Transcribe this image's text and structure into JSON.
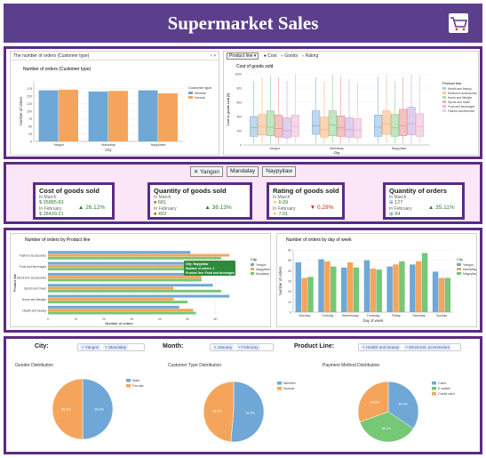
{
  "header": {
    "title": "Supermarket Sales",
    "icon": "cart-icon"
  },
  "top_left": {
    "tab": "The number of orders (Customer type)",
    "chart_title": "Number of orders (Customer type)",
    "chart_data": {
      "type": "bar",
      "categories": [
        "Yangon",
        "Mandalay",
        "Naypyitaw"
      ],
      "series": [
        {
          "name": "Member",
          "values": [
            169,
            165,
            169
          ],
          "color": "#6fa8d6"
        },
        {
          "name": "Normal",
          "values": [
            171,
            167,
            159
          ],
          "color": "#f5a55b"
        }
      ],
      "xlabel": "City",
      "ylabel": "Number of orders",
      "legend_title": "Customer type",
      "ylim": [
        0,
        200
      ],
      "yticks": [
        0,
        25,
        50,
        75,
        100,
        125,
        150,
        175
      ]
    }
  },
  "top_right": {
    "tab": "Product line",
    "toggles": [
      "Cost",
      "Goods",
      "Rating"
    ],
    "chart_title": "Cost of goods sold",
    "chart_data": {
      "type": "box",
      "categories": [
        "Yangon",
        "Mandalay",
        "Naypyitaw"
      ],
      "series_names": [
        "Health and beauty",
        "Electronic accessories",
        "Home and lifestyle",
        "Sports and travel",
        "Food and beverages",
        "Fashion accessories"
      ],
      "colors": [
        "#6fa8d6",
        "#f5a55b",
        "#76c776",
        "#e77b7b",
        "#b795d6",
        "#e9a6c8"
      ],
      "boxes": [
        [
          [
            20,
            120,
            240,
            400,
            900
          ],
          [
            30,
            140,
            260,
            430,
            950
          ],
          [
            25,
            130,
            250,
            480,
            980
          ],
          [
            20,
            110,
            230,
            420,
            950
          ],
          [
            20,
            100,
            200,
            380,
            900
          ],
          [
            30,
            120,
            260,
            420,
            990
          ]
        ],
        [
          [
            20,
            150,
            270,
            480,
            950
          ],
          [
            20,
            110,
            220,
            390,
            900
          ],
          [
            30,
            130,
            280,
            480,
            990
          ],
          [
            20,
            120,
            240,
            410,
            960
          ],
          [
            25,
            110,
            220,
            380,
            930
          ],
          [
            20,
            100,
            210,
            370,
            880
          ]
        ],
        [
          [
            20,
            120,
            250,
            420,
            960
          ],
          [
            30,
            150,
            290,
            480,
            990
          ],
          [
            20,
            120,
            240,
            430,
            900
          ],
          [
            20,
            130,
            270,
            500,
            950
          ],
          [
            20,
            140,
            300,
            530,
            990
          ],
          [
            30,
            120,
            260,
            440,
            980
          ]
        ]
      ],
      "xlabel": "City",
      "ylabel": "Cost of goods sold ($)",
      "legend_title": "Product line",
      "ylim": [
        0,
        1000
      ],
      "yticks": [
        0,
        200,
        400,
        600,
        800,
        1000
      ]
    }
  },
  "filters": {
    "buttons": [
      "Yangon",
      "Mandalay",
      "Naypyitaw"
    ],
    "selected": "Yangon"
  },
  "kpis": [
    {
      "title": "Cost of goods sold",
      "sub1": "In March",
      "v1": "35885.83",
      "delta": "26.12%",
      "delta_dir": "up",
      "sub2": "In February",
      "v2": "28439.21",
      "icon1": "dollar-icon",
      "icon2": "dollar-icon"
    },
    {
      "title": "Quantity of goods sold",
      "sub1": "In March",
      "v1": "681",
      "delta": "38.13%",
      "delta_dir": "up",
      "sub2": "In February",
      "v2": "493",
      "icon1": "box-icon",
      "icon2": "box-icon"
    },
    {
      "title": "Rating of goods sold",
      "sub1": "In March",
      "v1": "6.99",
      "delta": "0.29%",
      "delta_dir": "down",
      "sub2": "In February",
      "v2": "7.01",
      "icon1": "star-icon",
      "icon2": "star-icon"
    },
    {
      "title": "Quantity of orders",
      "sub1": "In March",
      "v1": "127",
      "delta": "35.11%",
      "delta_dir": "up",
      "sub2": "In February",
      "v2": "94",
      "icon1": "cart-icon",
      "icon2": "cart-icon"
    }
  ],
  "mid_left": {
    "chart_title": "Number of orders by Product line",
    "chart_data": {
      "type": "bar-horizontal",
      "categories": [
        "Fashion accessories",
        "Food and beverages",
        "Electronic accessories",
        "Sports and travel",
        "Home and lifestyle",
        "Health and beauty"
      ],
      "series": [
        {
          "name": "Yangon",
          "values": [
            51,
            58,
            55,
            59,
            65,
            47
          ],
          "color": "#6fa8d6"
        },
        {
          "name": "Naypyitaw",
          "values": [
            65,
            66,
            55,
            45,
            45,
            52
          ],
          "color": "#f5a55b"
        },
        {
          "name": "Mandalay",
          "values": [
            62,
            50,
            55,
            62,
            50,
            53
          ],
          "color": "#76c776"
        }
      ],
      "xlabel": "Number of orders",
      "ylabel": "Product line",
      "legend_title": "City",
      "xlim": [
        0,
        70
      ],
      "xticks": [
        0,
        10,
        20,
        30,
        40,
        50,
        60
      ],
      "tooltip": [
        "City: Naypyitaw",
        "Number of orders: 1",
        "Product line: Food and beverages"
      ]
    }
  },
  "mid_right": {
    "chart_title": "Number of orders by day of week",
    "chart_data": {
      "type": "bar",
      "categories": [
        "Monday",
        "Tuesday",
        "Wednesday",
        "Thursday",
        "Friday",
        "Saturday",
        "Sunday"
      ],
      "series": [
        {
          "name": "Yangon",
          "values": [
            48,
            51,
            43,
            50,
            44,
            46,
            39
          ],
          "color": "#6fa8d6"
        },
        {
          "name": "Mandalay",
          "values": [
            33,
            49,
            48,
            42,
            46,
            49,
            33
          ],
          "color": "#f5a55b"
        },
        {
          "name": "Naypyitaw",
          "values": [
            34,
            44,
            43,
            41,
            49,
            57,
            33
          ],
          "color": "#76c776"
        }
      ],
      "xlabel": "Day of week",
      "ylabel": "Number of orders",
      "legend_title": "City",
      "ylim": [
        0,
        60
      ],
      "yticks": [
        0,
        10,
        20,
        30,
        40,
        50,
        60
      ]
    }
  },
  "bottom": {
    "filters": [
      {
        "label": "City:",
        "tags": [
          "Yangon",
          "Mandalay"
        ]
      },
      {
        "label": "Month:",
        "tags": [
          "January",
          "February"
        ]
      },
      {
        "label": "Product Line:",
        "tags": [
          "Health and beauty",
          "Electronic accessories"
        ]
      }
    ],
    "pies": [
      {
        "title": "Gender Distribution",
        "chart_data": {
          "type": "pie",
          "labels": [
            "Male",
            "Female"
          ],
          "values": [
            50.0,
            50.0
          ],
          "colors": [
            "#6fa8d6",
            "#f5a55b"
          ]
        }
      },
      {
        "title": "Customer Type Distribution",
        "chart_data": {
          "type": "pie",
          "labels": [
            "Member",
            "Normal"
          ],
          "values": [
            51.5,
            48.5
          ],
          "colors": [
            "#6fa8d6",
            "#f5a55b"
          ]
        }
      },
      {
        "title": "Payment Method Distribution",
        "chart_data": {
          "type": "pie",
          "labels": [
            "Cash",
            "E-wallet",
            "Credit card"
          ],
          "values": [
            34.4,
            35.1,
            30.5
          ],
          "colors": [
            "#6fa8d6",
            "#76c776",
            "#f5a55b"
          ]
        }
      }
    ]
  }
}
